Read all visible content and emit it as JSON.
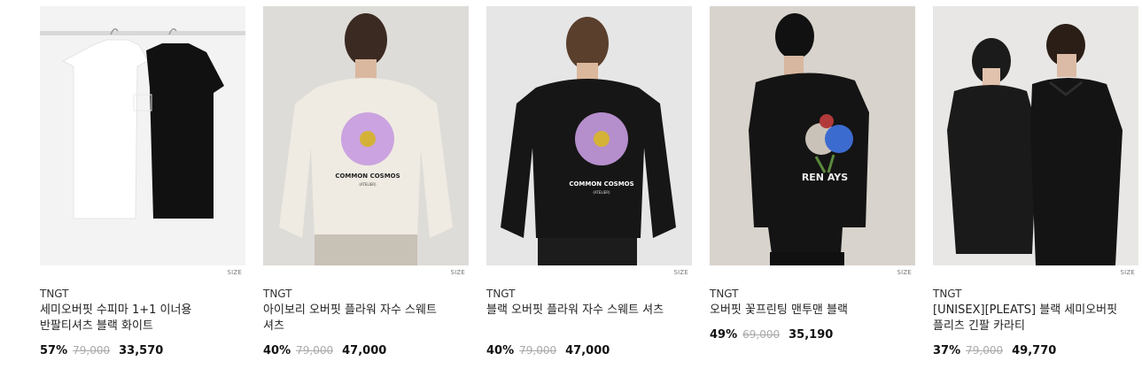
{
  "products": [
    {
      "brand": "TNGT",
      "name": "세미오버핏 수피마 1+1 이너용 반팔티셔츠 블랙 화이트",
      "discount": "57%",
      "original_price": "79,000",
      "sale_price": "33,570",
      "size_label": "SIZE"
    },
    {
      "brand": "TNGT",
      "name": "아이보리 오버핏 플라워 자수 스웨트 셔츠",
      "discount": "40%",
      "original_price": "79,000",
      "sale_price": "47,000",
      "size_label": "SIZE",
      "print_text": "COMMON COSMOS",
      "print_sub": "(ATELIER)"
    },
    {
      "brand": "TNGT",
      "name": "블랙 오버핏 플라워 자수 스웨트 셔츠",
      "discount": "40%",
      "original_price": "79,000",
      "sale_price": "47,000",
      "size_label": "SIZE",
      "print_text": "COMMON COSMOS",
      "print_sub": "(ATELIER)"
    },
    {
      "brand": "TNGT",
      "name": "오버핏 꽃프린팅 맨투맨 블랙",
      "discount": "49%",
      "original_price": "69,000",
      "sale_price": "35,190",
      "size_label": "SIZE",
      "print_text": "REN  AYS"
    },
    {
      "brand": "TNGT",
      "name": "[UNISEX][PLEATS] 블랙 세미오버핏 플리츠 긴팔 카라티",
      "discount": "37%",
      "original_price": "79,000",
      "sale_price": "49,770",
      "size_label": "SIZE"
    }
  ],
  "colors": {
    "accent": "#111111",
    "strike": "#aaaaaa",
    "ivory": "#efebe2",
    "black_garment": "#161616",
    "cosmos": "#c79be0"
  }
}
